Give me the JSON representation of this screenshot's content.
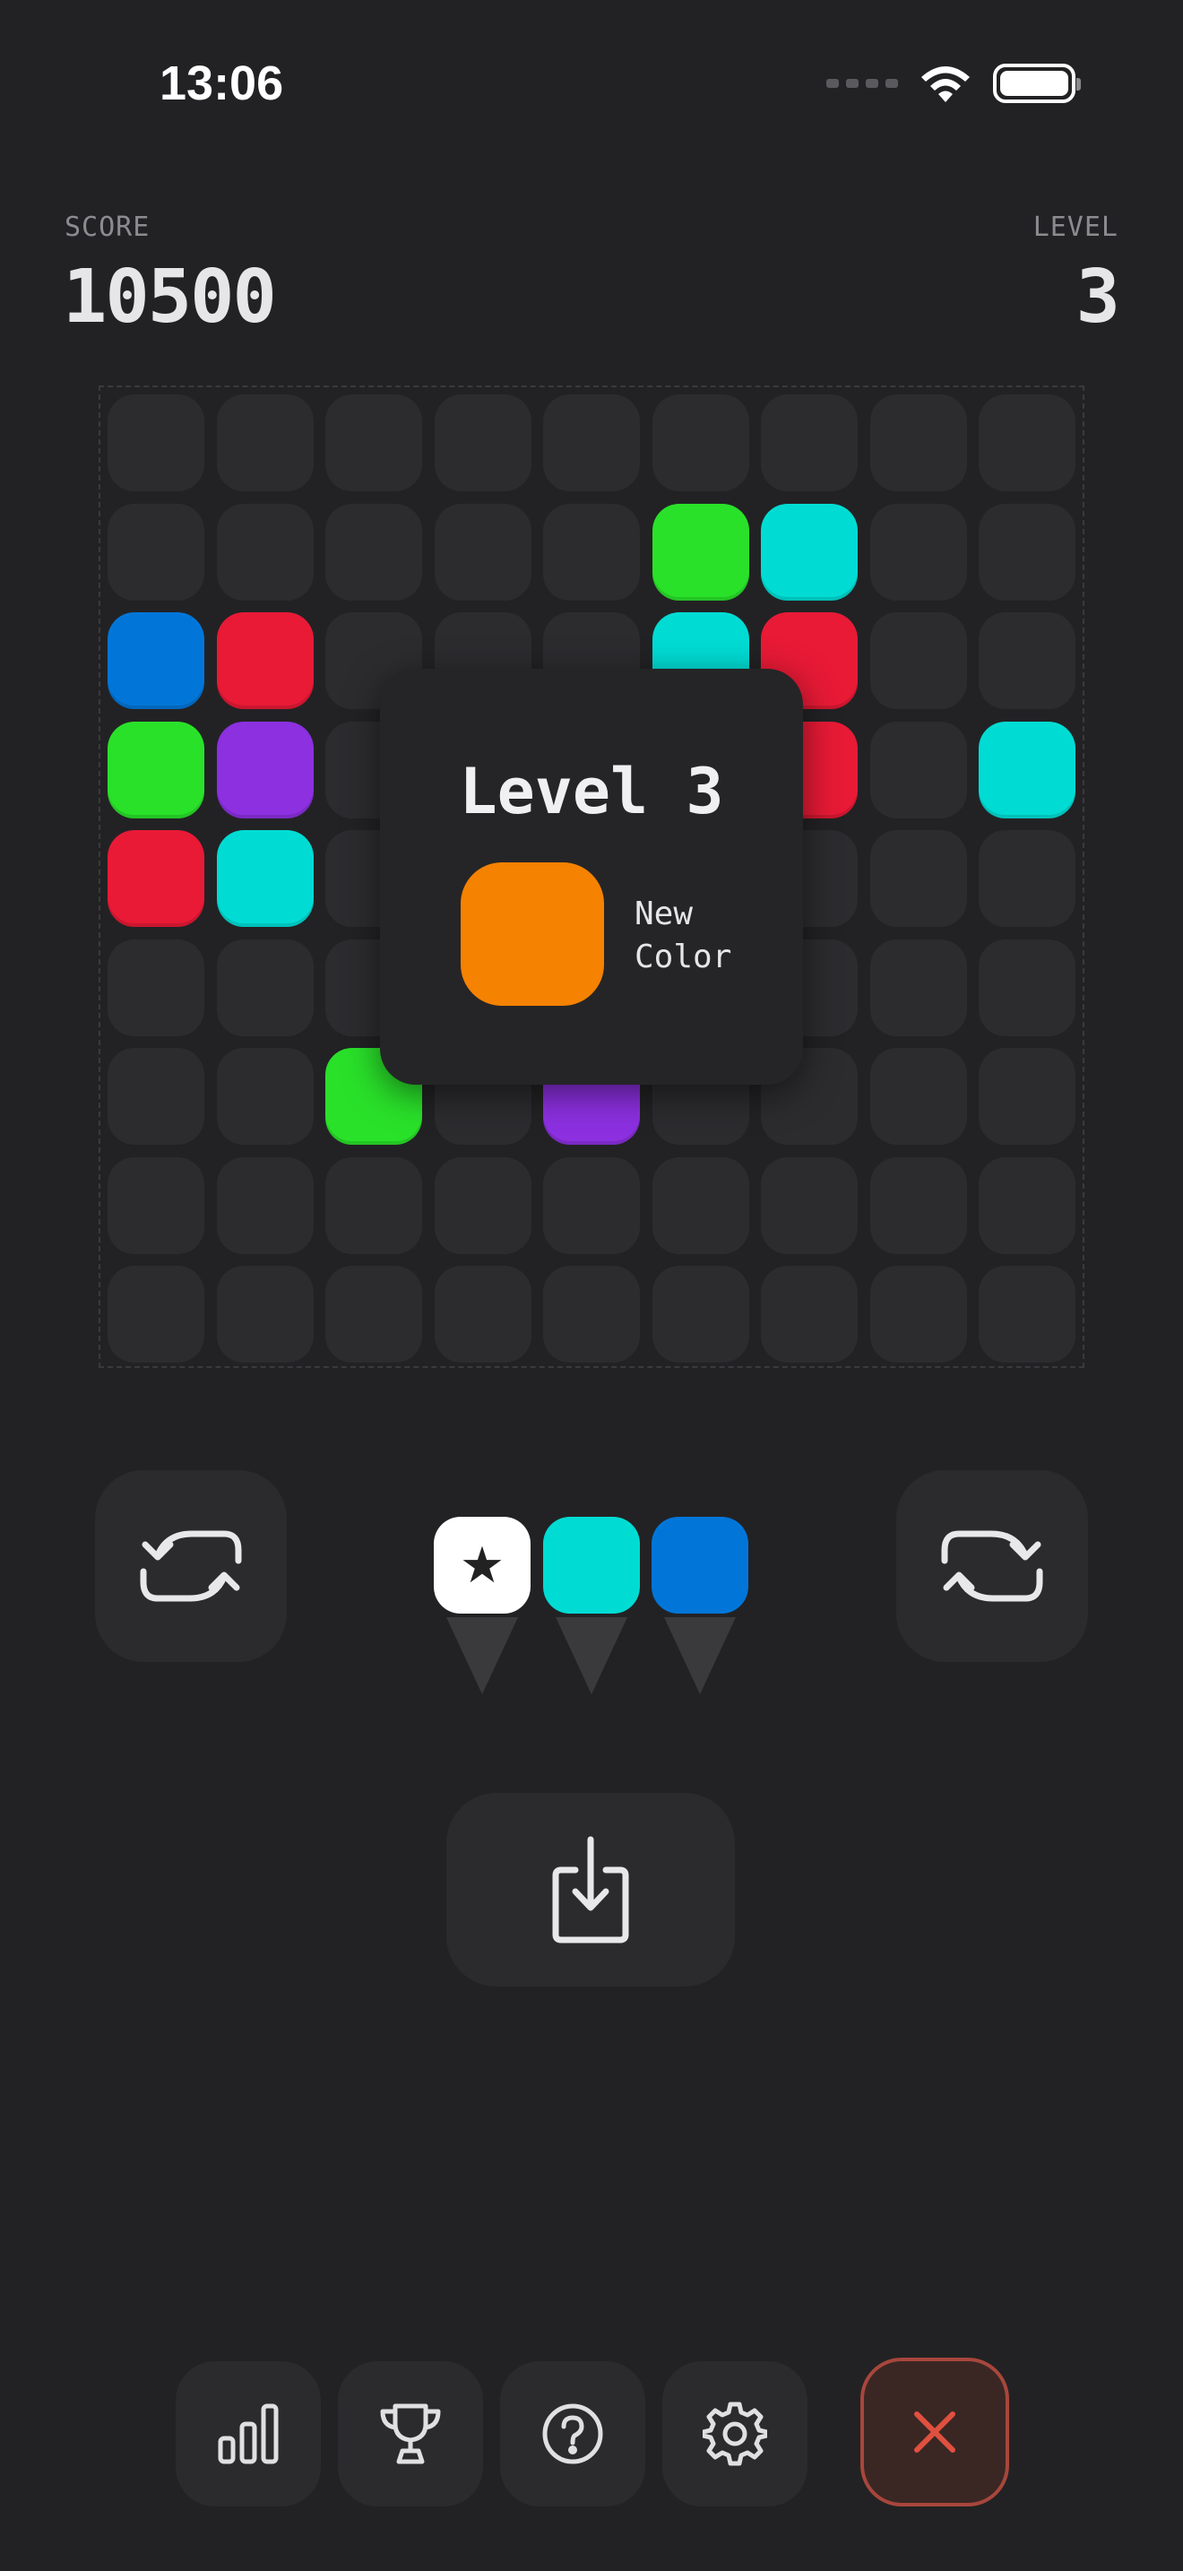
{
  "status": {
    "time": "13:06"
  },
  "hud": {
    "score_label": "SCORE",
    "score_value": "10500",
    "level_label": "LEVEL",
    "level_value": "3"
  },
  "colors": {
    "empty": "#2c2c2f",
    "green": "#2ae12a",
    "cyan": "#00dcd4",
    "blue": "#0276d8",
    "red": "#e81a36",
    "purple": "#8c30e0",
    "orange": "#f58200",
    "white": "#ffffff"
  },
  "board": {
    "rows": 9,
    "cols": 9,
    "cells": [
      [
        "",
        "",
        "",
        "",
        "",
        "",
        "",
        "",
        ""
      ],
      [
        "",
        "",
        "",
        "",
        "",
        "green",
        "cyan",
        "",
        ""
      ],
      [
        "blue",
        "red",
        "",
        "",
        "",
        "cyan",
        "red",
        "",
        ""
      ],
      [
        "green",
        "purple",
        "",
        "",
        "",
        "",
        "red",
        "",
        "cyan"
      ],
      [
        "red",
        "cyan",
        "",
        "",
        "",
        "",
        "",
        "",
        ""
      ],
      [
        "",
        "",
        "",
        "",
        "",
        "",
        "",
        "",
        ""
      ],
      [
        "",
        "",
        "green",
        "",
        "purple",
        "",
        "",
        "",
        ""
      ],
      [
        "",
        "",
        "",
        "",
        "",
        "",
        "",
        "",
        ""
      ],
      [
        "",
        "",
        "",
        "",
        "",
        "",
        "",
        "",
        ""
      ]
    ]
  },
  "popup": {
    "title": "Level 3",
    "swatch_color": "orange",
    "text_line1": "New",
    "text_line2": "Color"
  },
  "pieces": [
    {
      "color": "white",
      "symbol": "★"
    },
    {
      "color": "cyan",
      "symbol": ""
    },
    {
      "color": "blue",
      "symbol": ""
    }
  ],
  "controls": {
    "rotate_left": "rotate-ccw-icon",
    "rotate_right": "rotate-cw-icon",
    "drop": "download-icon"
  },
  "nav": [
    {
      "icon": "stats-icon"
    },
    {
      "icon": "trophy-icon"
    },
    {
      "icon": "help-icon"
    },
    {
      "icon": "settings-icon"
    },
    {
      "icon": "close-icon"
    }
  ]
}
